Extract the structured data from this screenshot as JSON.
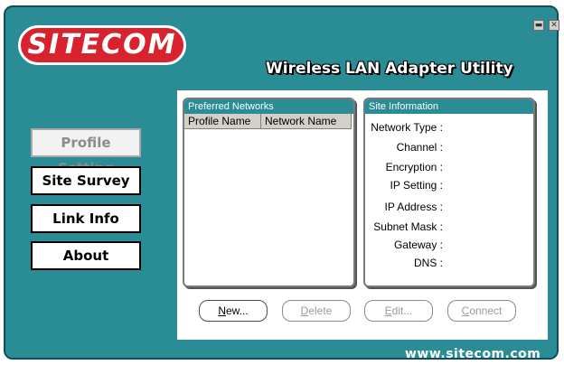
{
  "brand": {
    "logo_text": "SITECOM",
    "app_title": "Wireless LAN Adapter Utility",
    "url": "www.sitecom.com"
  },
  "window_controls": {
    "minimize": "▬",
    "close": "✕"
  },
  "nav": {
    "profile": "Profile Setting",
    "survey": "Site Survey",
    "link": "Link Info",
    "about": "About"
  },
  "preferred": {
    "title": "Preferred Networks",
    "columns": [
      "Profile Name",
      "Network Name"
    ]
  },
  "site_info": {
    "title": "Site Information",
    "labels": {
      "network_type": "Network Type :",
      "channel": "Channel :",
      "encryption": "Encryption :",
      "ip_setting": "IP Setting :",
      "ip_address": "IP Address :",
      "subnet_mask": "Subnet Mask :",
      "gateway": "Gateway :",
      "dns": "DNS :"
    }
  },
  "actions": {
    "new_first": "N",
    "new_rest": "ew...",
    "delete_first": "D",
    "delete_rest": "elete",
    "edit_first": "E",
    "edit_rest": "dit...",
    "connect_first": "C",
    "connect_rest": "onnect"
  },
  "colors": {
    "background": "#2a8d95",
    "logo": "#d8232e",
    "panel_header": "#2a8d95"
  }
}
